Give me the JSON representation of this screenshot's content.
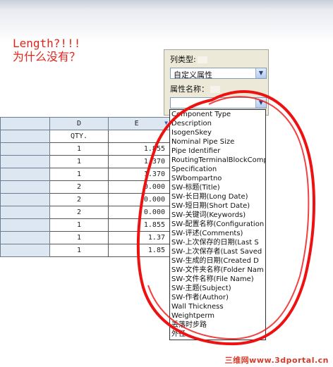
{
  "annotation": {
    "line1": "Length?!!!",
    "line2": "为什么没有？"
  },
  "table": {
    "columns": [
      "D",
      "E"
    ],
    "header_row": [
      "QTY.",
      ""
    ],
    "rows": [
      [
        "1",
        "1.855"
      ],
      [
        "1",
        "1.370"
      ],
      [
        "1",
        "1.370"
      ],
      [
        "2",
        "0.000"
      ],
      [
        "2",
        "0.000"
      ],
      [
        "2",
        "0.000"
      ],
      [
        "1",
        "1.855"
      ],
      [
        "1",
        "1.37"
      ],
      [
        "1",
        "1.85"
      ]
    ]
  },
  "panel": {
    "column_type_label": "列类型:",
    "column_type_value": "自定义属性",
    "property_name_label": "属性名称：",
    "property_name_value": ""
  },
  "dropdown": {
    "options": [
      "Component Type",
      "Description",
      "IsogenSkey",
      "Nominal Pipe Size",
      "Pipe Identifier",
      "RoutingTerminalBlockCompo",
      "Specification",
      "SWbompartno",
      "SW-标题(Title)",
      "SW-长日期(Long Date)",
      "SW-短日期(Short Date)",
      "SW-关键词(Keywords)",
      "SW-配置名称(Configuration",
      "SW-评述(Comments)",
      "SW-上次保存的日期(Last S",
      "SW-上次保存者(Last Saved",
      "SW-生成的日期(Created D",
      "SW-文件夹名称(Folder Nam",
      "SW-文件名称(File Name)",
      "SW-主题(Subject)",
      "SW-作者(Author)",
      "Wall Thickness",
      "Weightperm",
      "丢落时步路",
      "外径"
    ]
  },
  "watermark": "三维网www.3dportal.cn",
  "colors": {
    "annotation": "#e0241b",
    "ring": "#ee1111",
    "header_bg": "#dde7f2"
  }
}
